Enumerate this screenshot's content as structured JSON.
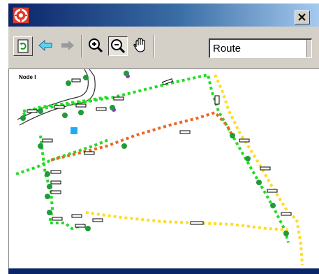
{
  "window": {
    "title": "",
    "app_icon": "lifebuoy-icon",
    "close_icon": "close-x-icon"
  },
  "toolbar": {
    "buttons": [
      {
        "name": "refresh",
        "icon": "refresh-icon"
      },
      {
        "name": "back",
        "icon": "arrow-left-icon"
      },
      {
        "name": "forward",
        "icon": "arrow-right-icon"
      },
      {
        "name": "zoom-in",
        "icon": "zoom-in-icon"
      },
      {
        "name": "zoom-out",
        "icon": "zoom-out-icon",
        "state": "pressed"
      },
      {
        "name": "pan",
        "icon": "hand-icon"
      }
    ],
    "route_label": "Route"
  },
  "map": {
    "node_label": "Node I",
    "route_colors": {
      "green": "#22dd22",
      "orange": "#ee6622",
      "yellow": "#ffdd22"
    },
    "marker_color": "#22aaee"
  },
  "colors": {
    "title_start": "#0a246a",
    "title_end": "#a6caf0",
    "chrome": "#d4d0c8"
  }
}
